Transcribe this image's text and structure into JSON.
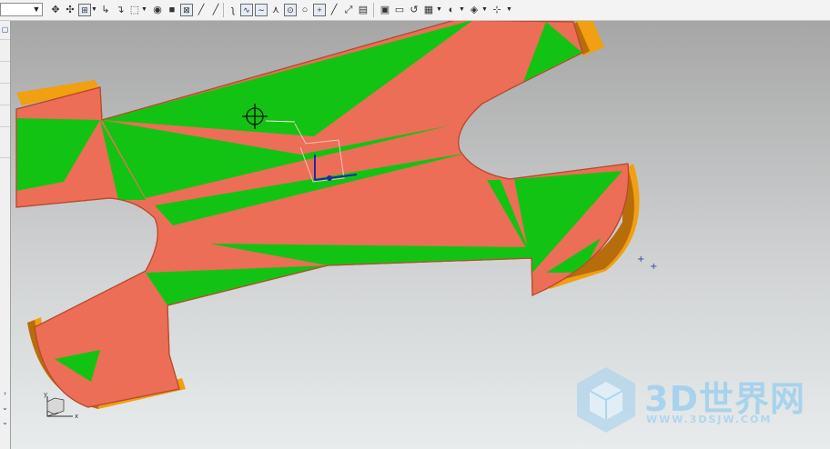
{
  "colors": {
    "face_red": "#ec6e57",
    "face_green": "#13c313",
    "wall_orange": "#f0a010",
    "wall_dark": "#b86d0c",
    "bg_top": "#a6a6a6",
    "bg_bottom": "#e8ecec",
    "watermark": "#9fd0ee"
  },
  "toolbar": {
    "icons": [
      "snap-icon",
      "transform-icon",
      "point-icon",
      "vector-icon",
      "select-box-icon",
      "render-icon",
      "solid-icon",
      "grid-icon",
      "line-icon",
      "curve-icon",
      "spline-icon",
      "analysis-icon",
      "fit-icon",
      "circle-icon",
      "plus-icon",
      "diagonal-icon",
      "scale-icon",
      "save-icon",
      "view-icon",
      "display-icon",
      "refresh-icon",
      "table-icon",
      "paint-icon",
      "cube-icon",
      "measure-icon"
    ]
  },
  "left_panel": {
    "glyphs": [
      "▢",
      "›",
      "⌄",
      "⌄"
    ]
  },
  "viewport": {
    "triad_axes": {
      "x": "x",
      "y": "y"
    },
    "crosshair_icon": "crosshair-icon"
  },
  "watermark": {
    "title": "3D世界网",
    "url": "WWW.3DSJW.COM"
  }
}
